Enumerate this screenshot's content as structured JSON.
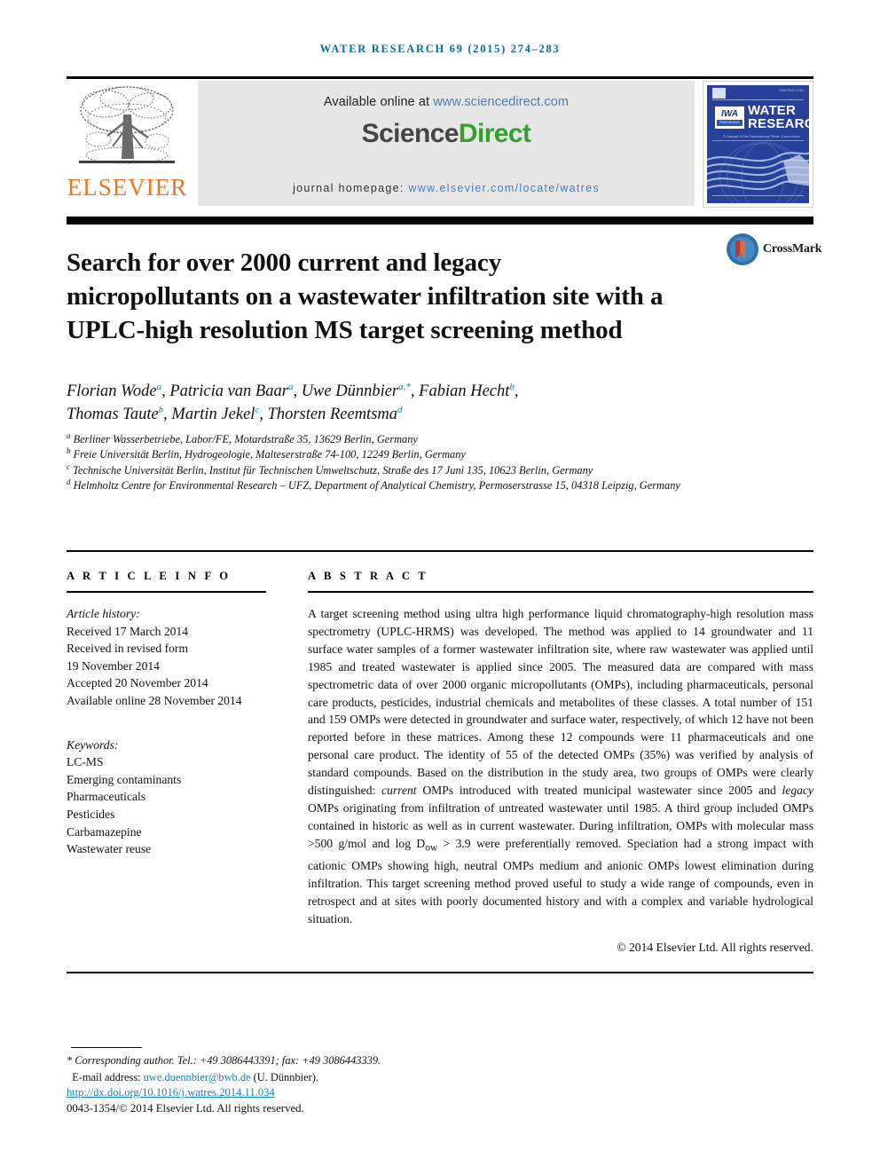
{
  "running_head": "WATER RESEARCH 69 (2015) 274–283",
  "banner": {
    "publisher_name": "ELSEVIER",
    "available_prefix": "Available online at ",
    "available_link": "www.sciencedirect.com",
    "logo_part1": "Science",
    "logo_part2": "Direct",
    "homepage_label": "journal homepage: ",
    "homepage_link": "www.elsevier.com/locate/watres",
    "cover": {
      "title_line1": "WATER",
      "title_line2": "RESEARCH",
      "iwa_top": "IWA",
      "iwa_bottom": "PUBLISHING",
      "subtitle": "A Journal of the International Water Association",
      "issn": "ISSN 0043-1354"
    }
  },
  "article": {
    "title": "Search for over 2000 current and legacy micropollutants on a wastewater infiltration site with a UPLC-high resolution MS target screening method",
    "crossmark_label": "CrossMark",
    "authors_line1_parts": [
      {
        "name": "Florian Wode",
        "sup": "a",
        "sep": ", "
      },
      {
        "name": "Patricia van Baar",
        "sup": "a",
        "sep": ", "
      },
      {
        "name": "Uwe Dünnbier",
        "sup": "a,*",
        "sep": ", "
      },
      {
        "name": "Fabian Hecht",
        "sup": "b",
        "sep": ","
      }
    ],
    "authors_line2_parts": [
      {
        "name": "Thomas Taute",
        "sup": "b",
        "sep": ", "
      },
      {
        "name": "Martin Jekel",
        "sup": "c",
        "sep": ", "
      },
      {
        "name": "Thorsten Reemtsma",
        "sup": "d",
        "sep": ""
      }
    ],
    "affiliations": [
      {
        "marker": "a",
        "text": "Berliner Wasserbetriebe, Labor/FE, Motardstraße 35, 13629 Berlin, Germany"
      },
      {
        "marker": "b",
        "text": "Freie Universität Berlin, Hydrogeologie, Malteserstraße 74-100, 12249 Berlin, Germany"
      },
      {
        "marker": "c",
        "text": "Technische Universität Berlin, Institut für Technischen Umweltschutz, Straße des 17 Juni 135, 10623 Berlin, Germany"
      },
      {
        "marker": "d",
        "text": "Helmholtz Centre for Environmental Research – UFZ, Department of Analytical Chemistry, Permoserstrasse 15, 04318 Leipzig, Germany"
      }
    ]
  },
  "article_info": {
    "heading": "A R T I C L E   I N F O",
    "history_label": "Article history:",
    "history": [
      "Received 17 March 2014",
      "Received in revised form",
      "19 November 2014",
      "Accepted 20 November 2014",
      "Available online 28 November 2014"
    ],
    "keywords_label": "Keywords:",
    "keywords": [
      "LC-MS",
      "Emerging contaminants",
      "Pharmaceuticals",
      "Pesticides",
      "Carbamazepine",
      "Wastewater reuse"
    ]
  },
  "abstract": {
    "heading": "A B S T R A C T",
    "paragraph_1": "A target screening method using ultra high performance liquid chromatography-high resolution mass spectrometry (UPLC-HRMS) was developed. The method was applied to 14 groundwater and 11 surface water samples of a former wastewater infiltration site, where raw wastewater was applied until 1985 and treated wastewater is applied since 2005. The measured data are compared with mass spectrometric data of over 2000 organic micropollutants (OMPs), including pharmaceuticals, personal care products, pesticides, industrial chemicals and metabolites of these classes. A total number of 151 and 159 OMPs were detected in groundwater and surface water, respectively, of which 12 have not been reported before in these matrices. Among these 12 compounds were 11 pharmaceuticals and one personal care product. The identity of 55 of the detected OMPs (35%) was verified by analysis of standard compounds. Based on the distribution in the study area, two groups of OMPs were clearly distinguished: ",
    "emph_1": "current",
    "paragraph_2": " OMPs introduced with treated municipal wastewater since 2005 and ",
    "emph_2": "legacy",
    "paragraph_3": " OMPs originating from infiltration of untreated wastewater until 1985. A third group included OMPs contained in historic as well as in current wastewater. During infiltration, OMPs with molecular mass >500 g/mol and log D",
    "sub_ow": "ow",
    "paragraph_4": " > 3.9 were preferentially removed. Speciation had a strong impact with cationic OMPs showing high, neutral OMPs medium and anionic OMPs lowest elimination during infiltration. This target screening method proved useful to study a wide range of compounds, even in retrospect and at sites with poorly documented history and with a complex and variable hydrological situation.",
    "copyright": "© 2014 Elsevier Ltd. All rights reserved."
  },
  "footer": {
    "corresponding": "* Corresponding author. Tel.: +49 3086443391; fax: +49 3086443339.",
    "email_label": "E-mail address: ",
    "email": "uwe.duennbier@bwb.de",
    "email_suffix": " (U. Dünnbier).",
    "doi": "http://dx.doi.org/10.1016/j.watres.2014.11.034",
    "issn_copyright": "0043-1354/© 2014 Elsevier Ltd. All rights reserved."
  },
  "colors": {
    "running_head": "#0b6a9b",
    "link": "#1a7fb5",
    "sciencedirect_link": "#4b7eb8",
    "elsevier_orange": "#E87722",
    "sciencedirect_green": "#33a02c",
    "cover_blue": "#27409a",
    "banner_gray": "#e6e6e6"
  }
}
